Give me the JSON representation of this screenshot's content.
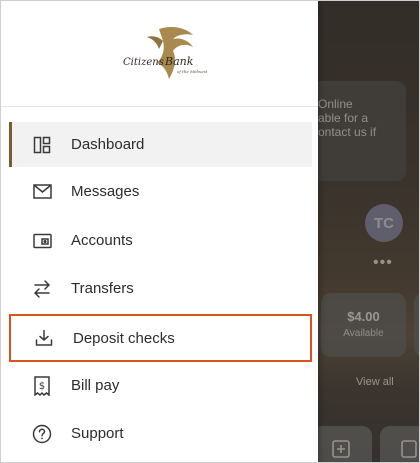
{
  "drawer": {
    "logo_alt": "Citizens Bank of the Midwest",
    "logo_text": "Citizens Bank",
    "logo_subtext": "of the Midwest",
    "items": [
      {
        "label": "Dashboard",
        "icon": "dashboard-icon",
        "active": true
      },
      {
        "label": "Messages",
        "icon": "mail-icon"
      },
      {
        "label": "Accounts",
        "icon": "accounts-icon"
      },
      {
        "label": "Transfers",
        "icon": "transfer-arrows-icon"
      },
      {
        "label": "Deposit checks",
        "icon": "download-tray-icon",
        "highlighted": true
      },
      {
        "label": "Bill pay",
        "icon": "bill-dollar-icon"
      },
      {
        "label": "Support",
        "icon": "help-circle-icon"
      }
    ],
    "highlight_color": "#d9531e",
    "active_color": "#7a5c2e"
  },
  "background": {
    "notice_lines": [
      "Online",
      "able for a",
      "ontact us if"
    ],
    "avatar_initials": "TC",
    "more_dots": "•••",
    "balance_amount": "$4.00",
    "balance_label": "Available",
    "view_all": "View all"
  }
}
